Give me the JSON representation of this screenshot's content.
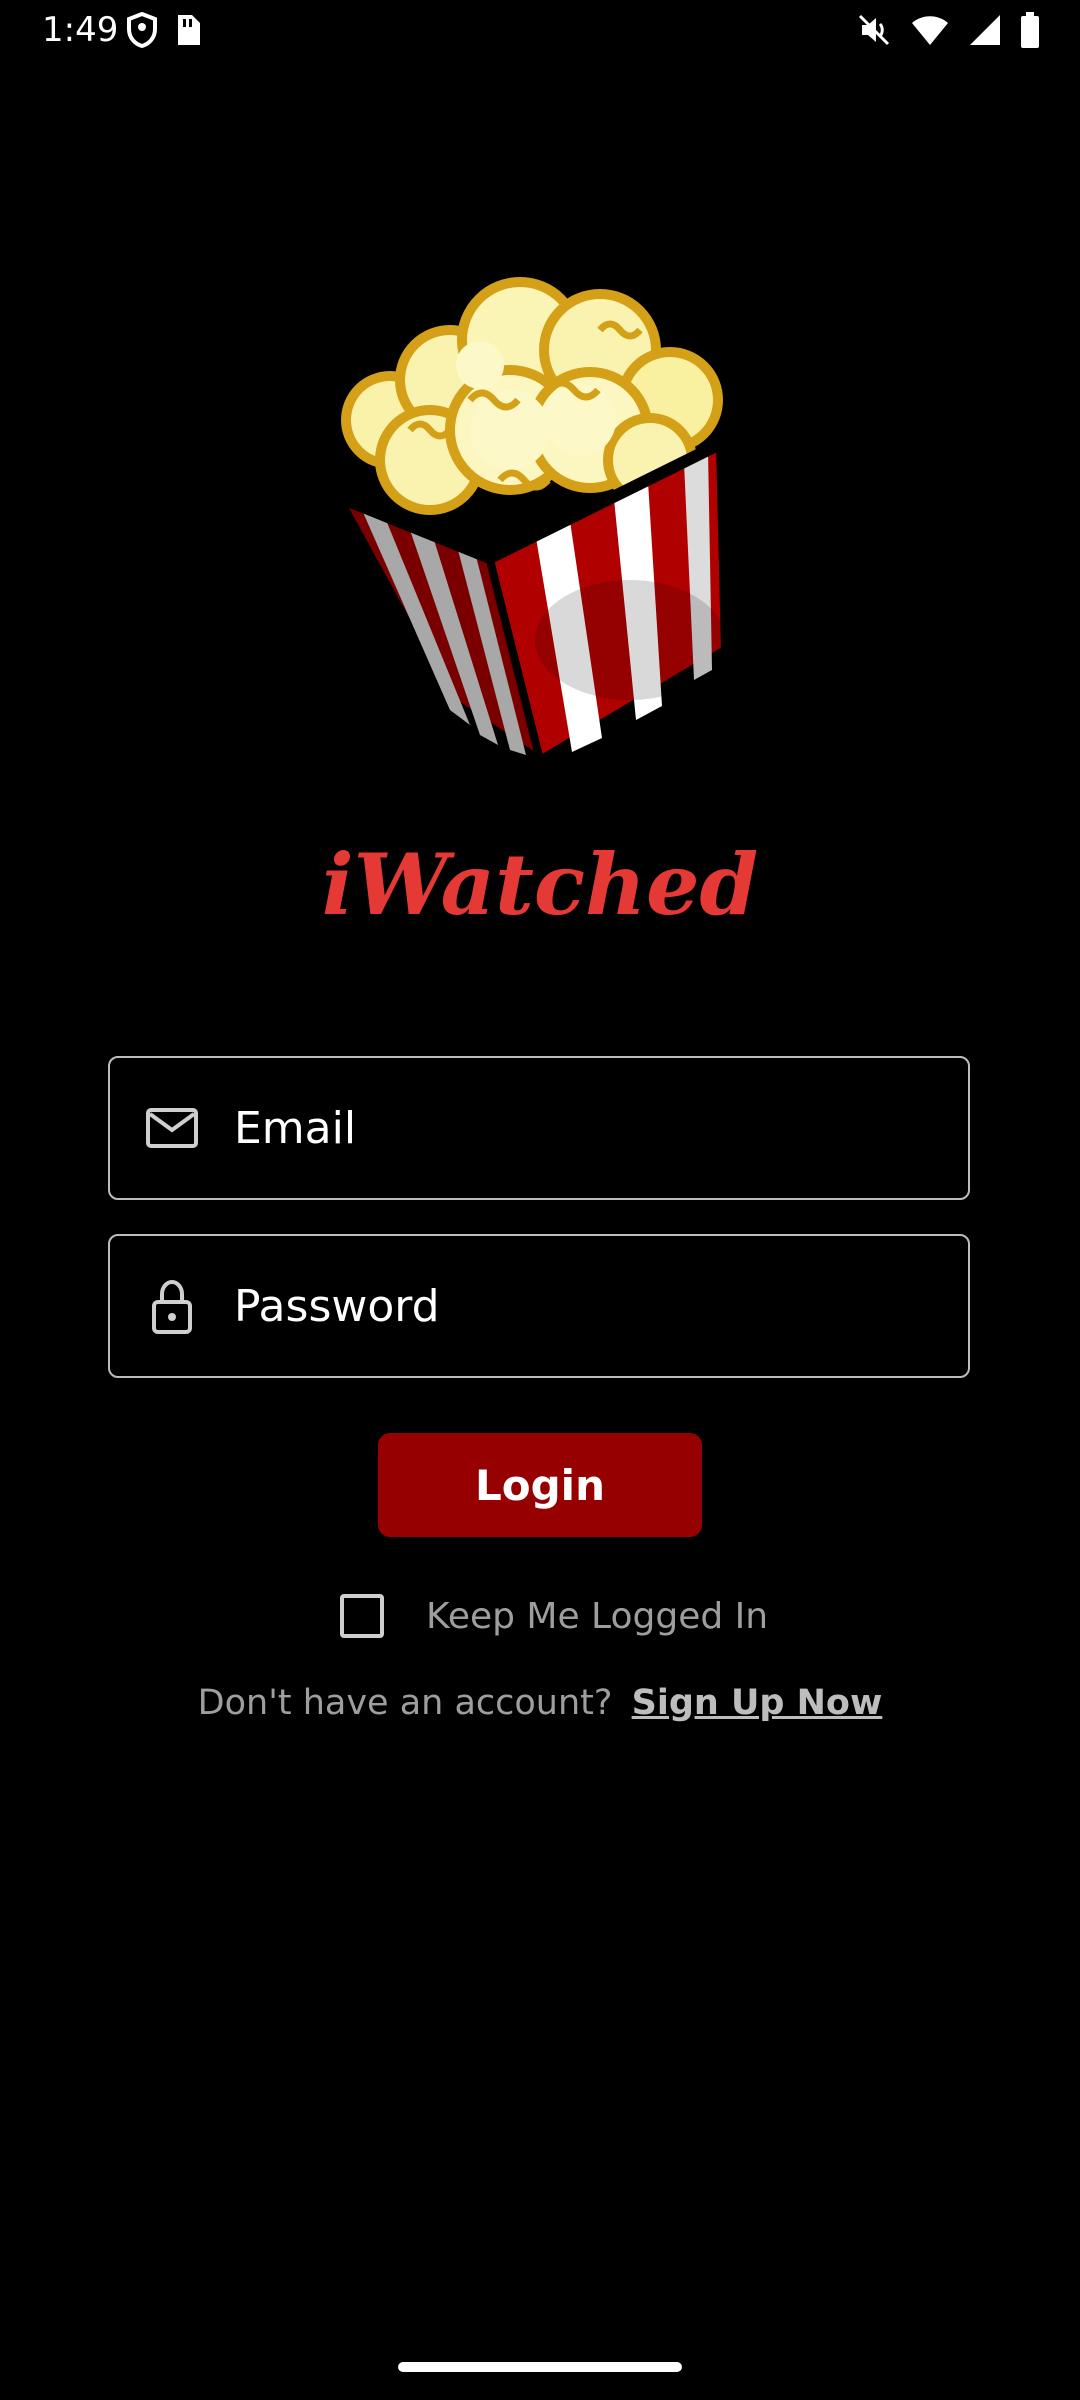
{
  "status_bar": {
    "time": "1:49",
    "icons": [
      "shield-icon",
      "sim-card-icon",
      "mute-icon",
      "wifi-icon",
      "signal-icon",
      "battery-icon"
    ]
  },
  "app": {
    "name": "iWatched",
    "logo": "popcorn-logo",
    "accent_color": "#e53935",
    "button_color": "#960000"
  },
  "form": {
    "email_placeholder": "Email",
    "email_value": "",
    "password_placeholder": "Password",
    "password_value": "",
    "login_label": "Login",
    "keep_logged_in_label": "Keep Me Logged In",
    "keep_logged_in_checked": false
  },
  "signup": {
    "prompt": "Don't have an account?",
    "link_label": "Sign Up Now"
  }
}
